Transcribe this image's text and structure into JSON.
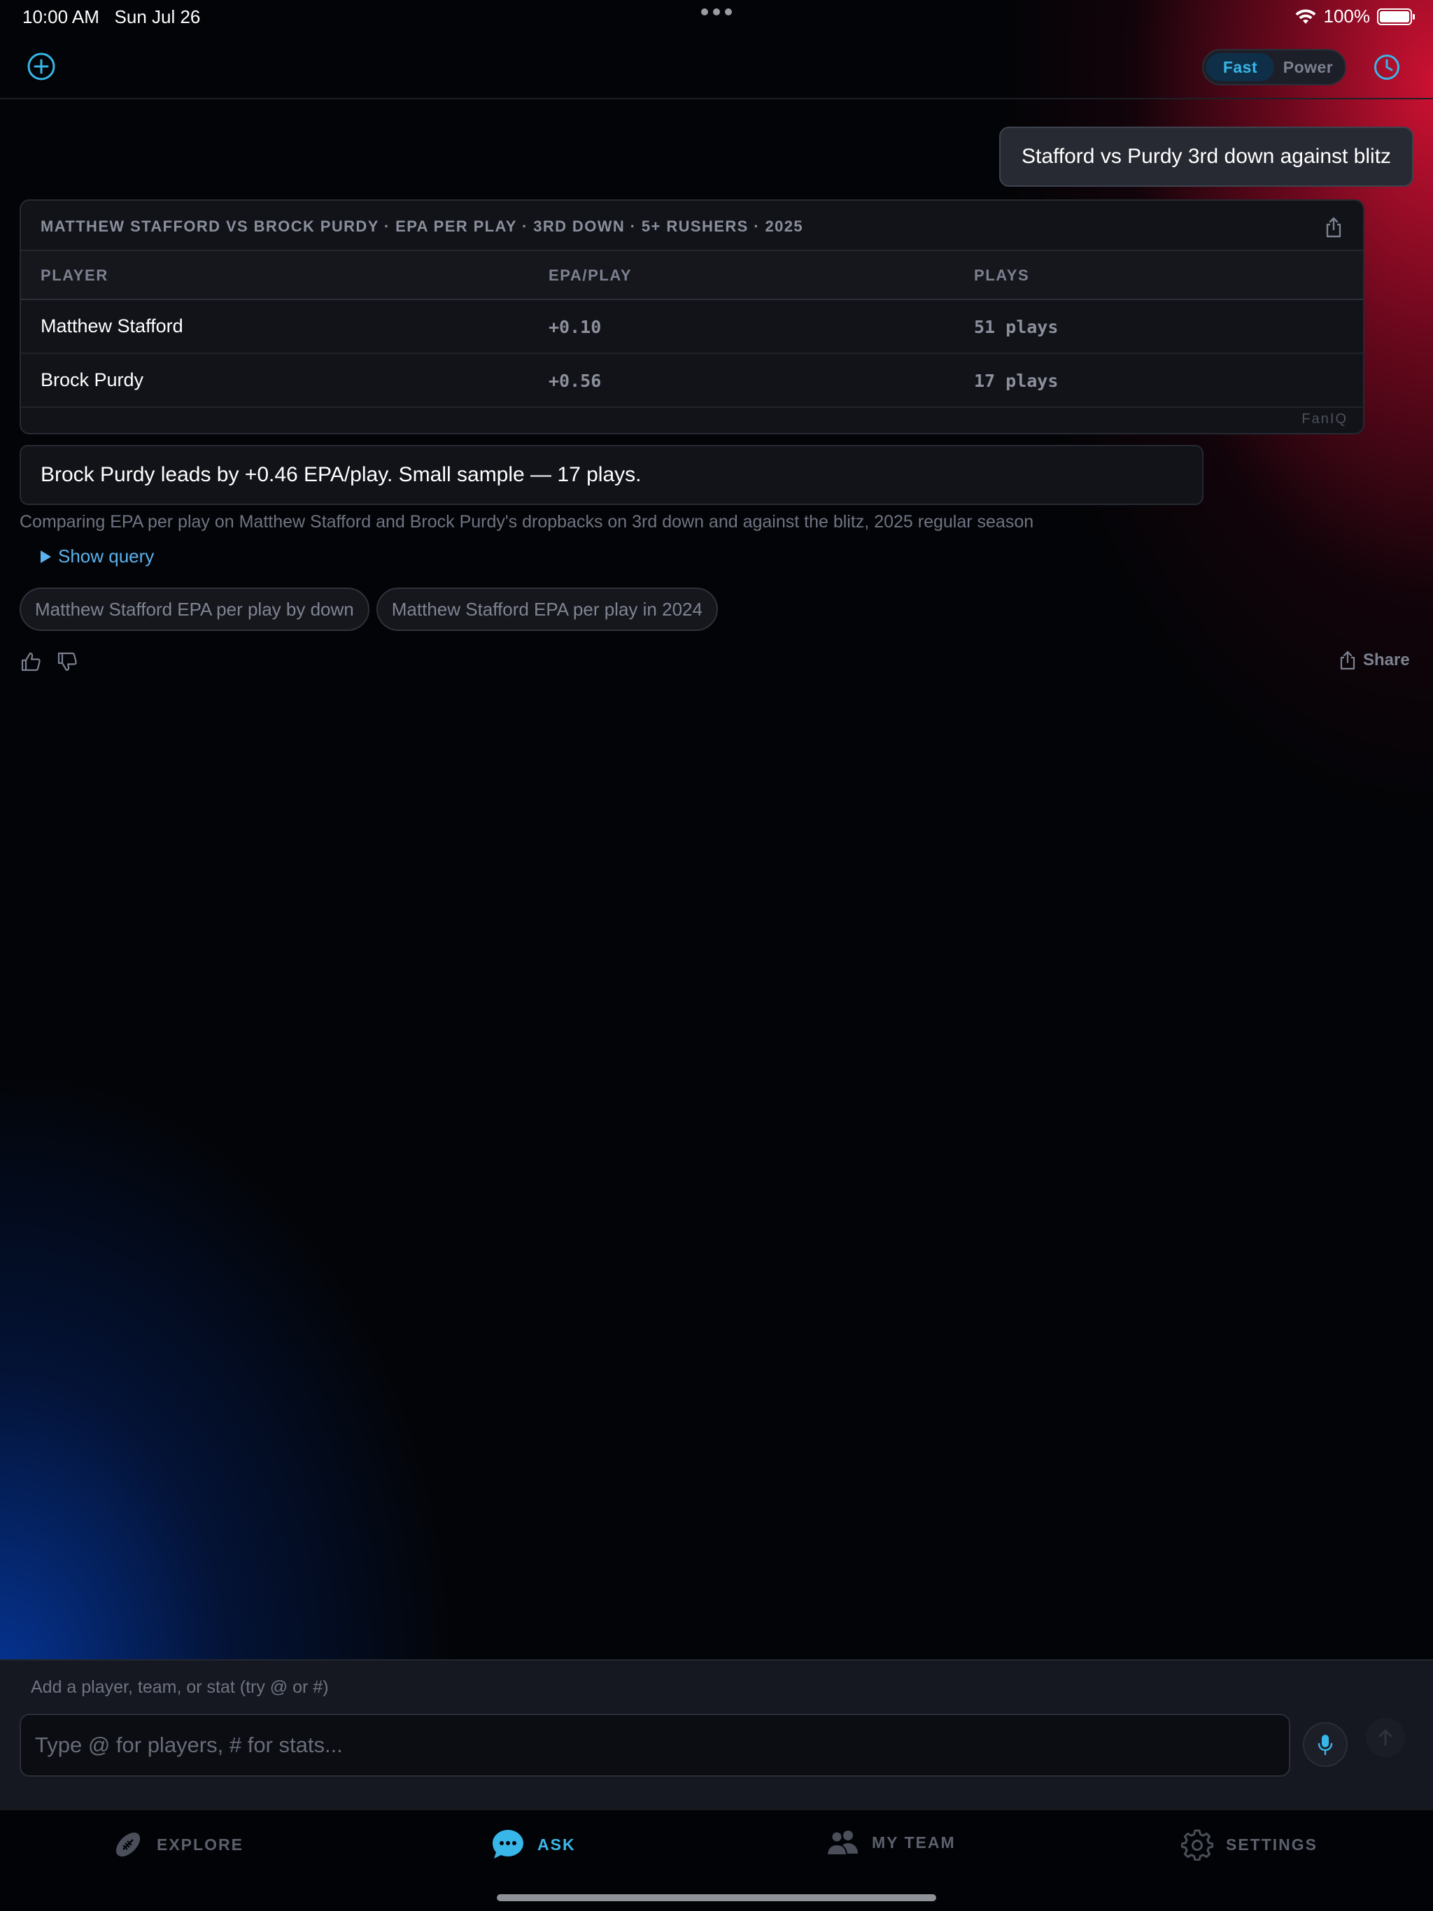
{
  "status_bar": {
    "time": "10:00 AM",
    "date": "Sun Jul 26",
    "battery": "100%"
  },
  "top_bar": {
    "new_chat_icon": "plus-circle-icon",
    "modes": [
      {
        "label": "Fast",
        "active": true
      },
      {
        "label": "Power",
        "active": false
      }
    ],
    "history_icon": "clock-icon"
  },
  "conversation": {
    "user_message": "Stafford vs Purdy 3rd down against blitz",
    "result_table": {
      "title": "MATTHEW STAFFORD VS BROCK PURDY · EPA PER PLAY · 3RD DOWN · 5+ RUSHERS · 2025",
      "columns": [
        "PLAYER",
        "EPA/PLAY",
        "PLAYS"
      ],
      "rows": [
        {
          "player": "Matthew Stafford",
          "epa": "+0.10",
          "plays": "51 plays"
        },
        {
          "player": "Brock Purdy",
          "epa": "+0.56",
          "plays": "17 plays"
        }
      ],
      "brand": "FanIQ"
    },
    "answer": "Brock Purdy leads by +0.46 EPA/play. Small sample — 17 plays.",
    "description": "Comparing EPA per play on Matthew Stafford and Brock Purdy's dropbacks on 3rd down and against the blitz, 2025 regular season",
    "show_query_label": "Show query",
    "suggestions": [
      "Matthew Stafford EPA per play by down",
      "Matthew Stafford EPA per play in 2024"
    ],
    "share_label": "Share"
  },
  "composer": {
    "hint": "Add a player, team, or stat (try @ or #)",
    "placeholder": "Type @ for players, # for stats..."
  },
  "tabs": [
    {
      "label": "EXPLORE",
      "icon": "football-icon",
      "active": false
    },
    {
      "label": "ASK",
      "icon": "chat-bubble-icon",
      "active": true
    },
    {
      "label": "MY TEAM",
      "icon": "people-icon",
      "active": false
    },
    {
      "label": "SETTINGS",
      "icon": "gear-icon",
      "active": false
    }
  ],
  "colors": {
    "accent": "#38b6e8",
    "link": "#5bb2ee",
    "background": "#030407",
    "card": "#121319"
  }
}
